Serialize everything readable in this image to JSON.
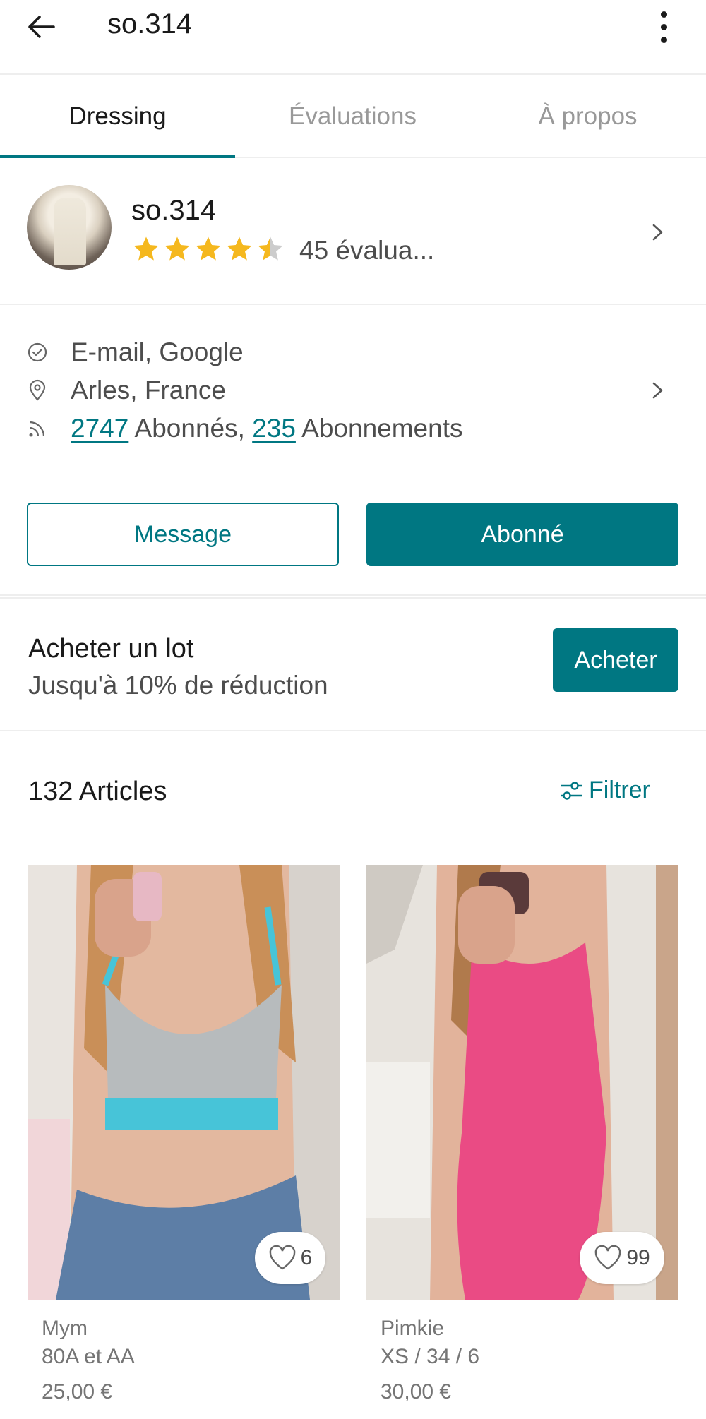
{
  "header": {
    "title": "so.314"
  },
  "tabs": [
    {
      "label": "Dressing",
      "active": true
    },
    {
      "label": "Évaluations",
      "active": false
    },
    {
      "label": "À propos",
      "active": false
    }
  ],
  "profile": {
    "name": "so.314",
    "rating": 4.5,
    "rating_max": 5,
    "rating_count_label": "45 évalua..."
  },
  "info": {
    "verified": "E-mail, Google",
    "location": "Arles, France",
    "followers_count": "2747",
    "followers_label": " Abonnés, ",
    "following_count": "235",
    "following_label": " Abonnements"
  },
  "actions": {
    "message_label": "Message",
    "follow_label": "Abonné"
  },
  "bundle": {
    "title": "Acheter un lot",
    "subtitle": "Jusqu'à 10% de réduction",
    "buy_label": "Acheter"
  },
  "items_header": {
    "count_label": "132 Articles",
    "filter_label": "Filtrer"
  },
  "items": [
    {
      "brand": "Mym",
      "size": "80A et AA",
      "price": "25,00 €",
      "favorites": "6"
    },
    {
      "brand": "Pimkie",
      "size": "XS / 34 / 6",
      "price": "30,00 €",
      "favorites": "99"
    }
  ],
  "colors": {
    "accent": "#007782",
    "star": "#f5b81e",
    "star_empty": "#cccccc"
  },
  "icons": [
    "back-arrow-icon",
    "more-vertical-icon",
    "star-icon",
    "chevron-right-icon",
    "verified-check-icon",
    "location-pin-icon",
    "rss-icon",
    "filter-sliders-icon",
    "heart-icon"
  ]
}
